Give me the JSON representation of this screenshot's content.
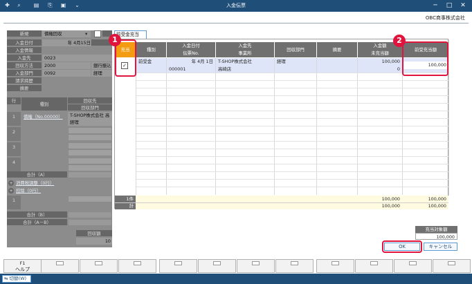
{
  "window": {
    "title": "入金伝票",
    "org": "OBC商事株式会社"
  },
  "left": {
    "new_label": "新規",
    "type_value": "債権回収",
    "rows": [
      {
        "k": "入金日付",
        "v": "年 4月15日"
      },
      {
        "k": "入金情報",
        "v": ""
      },
      {
        "k": "入金先",
        "v": "0023"
      },
      {
        "k": "回収方法",
        "v": "2000",
        "extra": "銀行振込"
      },
      {
        "k": "入金部門",
        "v": "0092",
        "extra": "経理"
      },
      {
        "k": "請求締歴",
        "v": ""
      },
      {
        "k": "摘要",
        "v": ""
      }
    ],
    "col_row": "行",
    "col_type": "種別",
    "col_collect": "回収先",
    "col_dept": "回収部門",
    "line1_link": "債権（No.00000）",
    "line1_name": "T-SHOP株式会社 高",
    "line1_dept": "経理",
    "line_numbers": [
      "1",
      "2",
      "3",
      "4"
    ],
    "total_a": "合計（A）",
    "tax_link": "消費税調整（0行）",
    "deduct_link": "控除（0行）",
    "total_b": "合計（B）",
    "total_ab": "合計（A－B）",
    "collect_amount_label": "回収額",
    "collect_amount_value": "10"
  },
  "panel": {
    "tab": "前受金充当",
    "headers": {
      "apply": "充当",
      "type": "種別",
      "date": "入金日付",
      "slip": "伝票No.",
      "payer": "入金先",
      "office": "事業所",
      "dept": "回収部門",
      "memo": "摘要",
      "amount": "入金額",
      "unapplied": "未充当額",
      "prepaid": "前受充当額"
    },
    "row": {
      "checked": "✓",
      "type": "前受金",
      "date": "年 4月 1日",
      "slip": "000001",
      "payer": "T-SHOP株式会社",
      "office": "高崎店",
      "dept": "経理",
      "amount": "100,000",
      "unapplied": "0",
      "prepaid": "100,000"
    },
    "count_label": "1件",
    "total_label": "計",
    "count_amount": "100,000",
    "count_prepaid": "100,000",
    "total_amount": "100,000",
    "total_prepaid": "100,000",
    "target_label": "充当対象額",
    "target_value": "100,000",
    "ok": "OK",
    "cancel": "キャンセル"
  },
  "annotations": {
    "one": "1",
    "two": "2"
  },
  "fkeys": {
    "f1": "F1",
    "f1_label": "ヘルプ"
  },
  "status": {
    "switch": "切替(W)"
  }
}
